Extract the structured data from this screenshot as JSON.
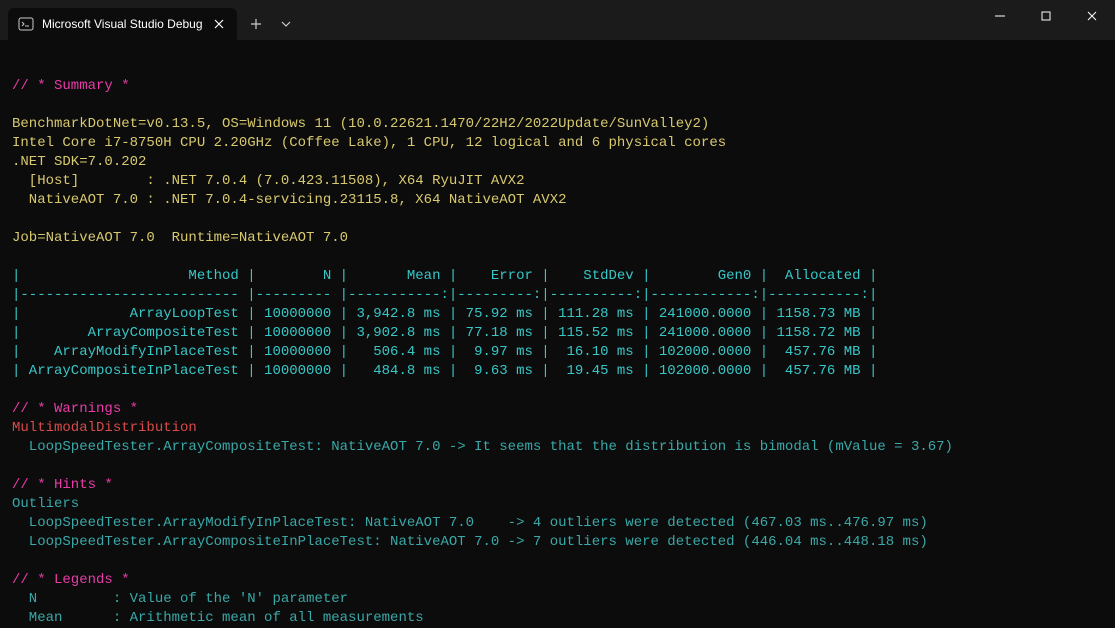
{
  "window": {
    "tab_title": "Microsoft Visual Studio Debug"
  },
  "sections": {
    "summary_header": "// * Summary *",
    "warnings_header": "// * Warnings *",
    "hints_header": "// * Hints *",
    "legends_header": "// * Legends *"
  },
  "env": {
    "line1": "BenchmarkDotNet=v0.13.5, OS=Windows 11 (10.0.22621.1470/22H2/2022Update/SunValley2)",
    "line2": "Intel Core i7-8750H CPU 2.20GHz (Coffee Lake), 1 CPU, 12 logical and 6 physical cores",
    "line3": ".NET SDK=7.0.202",
    "line4": "  [Host]        : .NET 7.0.4 (7.0.423.11508), X64 RyuJIT AVX2",
    "line5": "  NativeAOT 7.0 : .NET 7.0.4-servicing.23115.8, X64 NativeAOT AVX2",
    "job": "Job=NativeAOT 7.0  Runtime=NativeAOT 7.0"
  },
  "table": {
    "header": "|                    Method |        N |       Mean |    Error |    StdDev |        Gen0 |  Allocated |",
    "sep": "|-------------------------- |--------- |-----------:|---------:|----------:|------------:|-----------:|",
    "r1": "|             ArrayLoopTest | 10000000 | 3,942.8 ms | 75.92 ms | 111.28 ms | 241000.0000 | 1158.73 MB |",
    "r2": "|        ArrayCompositeTest | 10000000 | 3,902.8 ms | 77.18 ms | 115.52 ms | 241000.0000 | 1158.72 MB |",
    "r3": "|    ArrayModifyInPlaceTest | 10000000 |   506.4 ms |  9.97 ms |  16.10 ms | 102000.0000 |  457.76 MB |",
    "r4": "| ArrayCompositeInPlaceTest | 10000000 |   484.8 ms |  9.63 ms |  19.45 ms | 102000.0000 |  457.76 MB |"
  },
  "warnings": {
    "title": "MultimodalDistribution",
    "line1": "  LoopSpeedTester.ArrayCompositeTest: NativeAOT 7.0 -> It seems that the distribution is bimodal (mValue = 3.67)"
  },
  "hints": {
    "title": "Outliers",
    "line1": "  LoopSpeedTester.ArrayModifyInPlaceTest: NativeAOT 7.0    -> 4 outliers were detected (467.03 ms..476.97 ms)",
    "line2": "  LoopSpeedTester.ArrayCompositeInPlaceTest: NativeAOT 7.0 -> 7 outliers were detected (446.04 ms..448.18 ms)"
  },
  "legends": {
    "l1": "  N         : Value of the 'N' parameter",
    "l2": "  Mean      : Arithmetic mean of all measurements"
  }
}
